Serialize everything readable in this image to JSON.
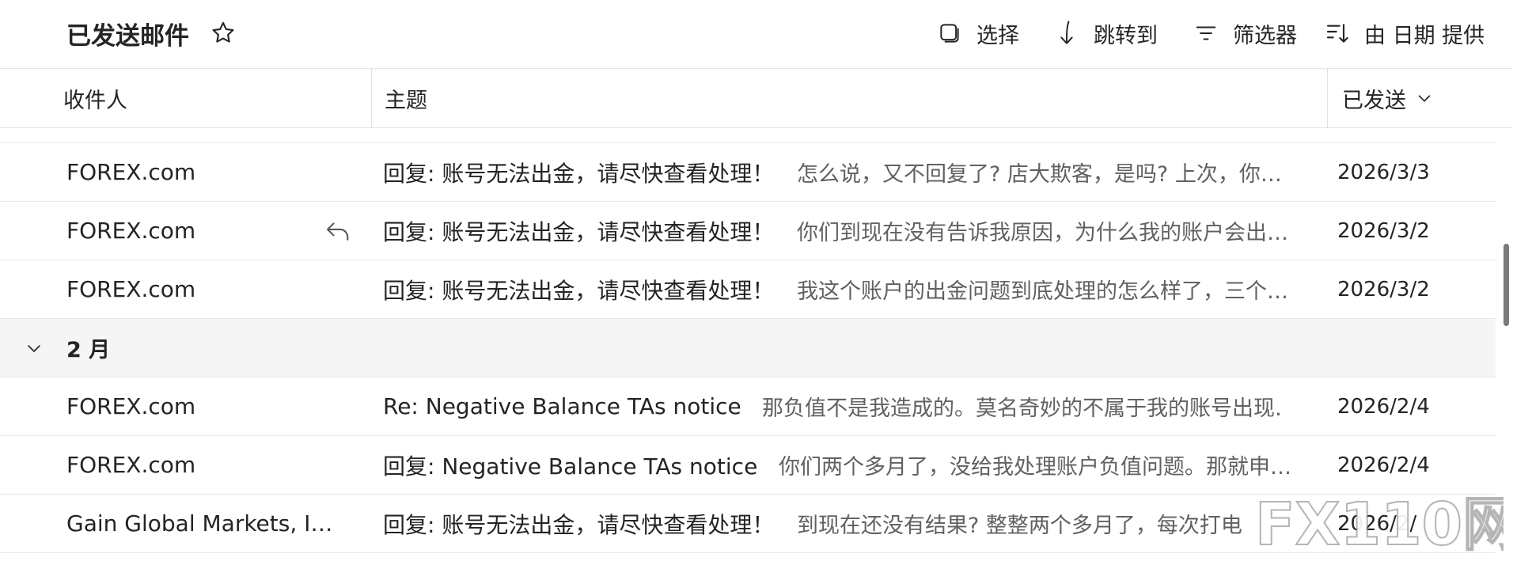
{
  "toolbar": {
    "folder_title": "已发送邮件",
    "star_icon": "star-outline-icon",
    "actions": {
      "select": "选择",
      "jump_to": "跳转到",
      "filter": "筛选器",
      "sort": "由 日期 提供"
    }
  },
  "columns": {
    "recipient": "收件人",
    "subject": "主题",
    "sent": "已发送"
  },
  "groups": {
    "february": "2 月"
  },
  "rows": [
    {
      "from": "FOREX.com",
      "subject": "回复: 账号无法出金，请尽快查看处理！",
      "preview": "怎么说，又不回复了? 店大欺客，是吗? 上次，你…",
      "date": "2026/3/3"
    },
    {
      "from": "FOREX.com",
      "subject": "回复: 账号无法出金，请尽快查看处理！",
      "preview": "你们到现在没有告诉我原因，为什么我的账户会出…",
      "date": "2026/3/2"
    },
    {
      "from": "FOREX.com",
      "subject": "回复: 账号无法出金，请尽快查看处理！",
      "preview": "我这个账户的出金问题到底处理的怎么样了，三个…",
      "date": "2026/3/2"
    },
    {
      "from": "FOREX.com",
      "subject": "Re: Negative Balance TAs notice",
      "preview": "那负值不是我造成的。莫名奇妙的不属于我的账号出现…",
      "date": "2026/2/4"
    },
    {
      "from": "FOREX.com",
      "subject": "回复: Negative Balance TAs notice",
      "preview": "你们两个多月了，没给我处理账户负值问题。那就申…",
      "date": "2026/2/4"
    },
    {
      "from": "Gain Global Markets, I…",
      "subject": "回复: 账号无法出金，请尽快查看处理！",
      "preview": "到现在还没有结果? 整整两个多月了，每次打电",
      "date": "2026/2/"
    }
  ],
  "watermark": "FX110网",
  "colors": {
    "text": "#242424",
    "preview": "#616161",
    "group_bg": "#f5f5f5",
    "divider": "#e1e1e1"
  }
}
